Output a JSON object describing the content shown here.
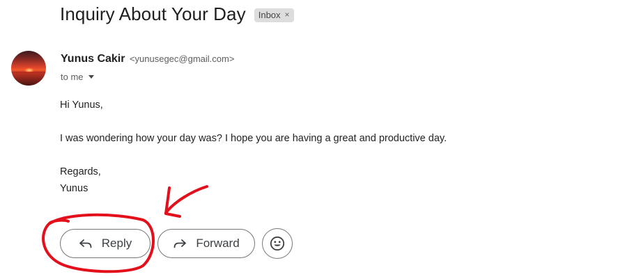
{
  "email": {
    "subject": "Inquiry About Your Day",
    "label": "Inbox",
    "label_remove": "×",
    "sender_name": "Yunus Cakir",
    "sender_email": "<yunusegec@gmail.com>",
    "recipient": "to me",
    "body": {
      "greeting": "Hi Yunus,",
      "paragraph": "I was wondering how your day was? I hope you are having a great and productive day.",
      "closing": "Regards,",
      "signature": "Yunus"
    }
  },
  "actions": {
    "reply_label": "Reply",
    "forward_label": "Forward"
  },
  "icons": {
    "avatar": "sunset-avatar",
    "reply": "reply-arrow-icon",
    "forward": "forward-arrow-icon",
    "emoji": "smiley-emoji-icon",
    "details": "chevron-down-icon"
  },
  "colors": {
    "annotation": "#e3101b",
    "chip_background": "#dddddd",
    "button_border": "#747775"
  }
}
